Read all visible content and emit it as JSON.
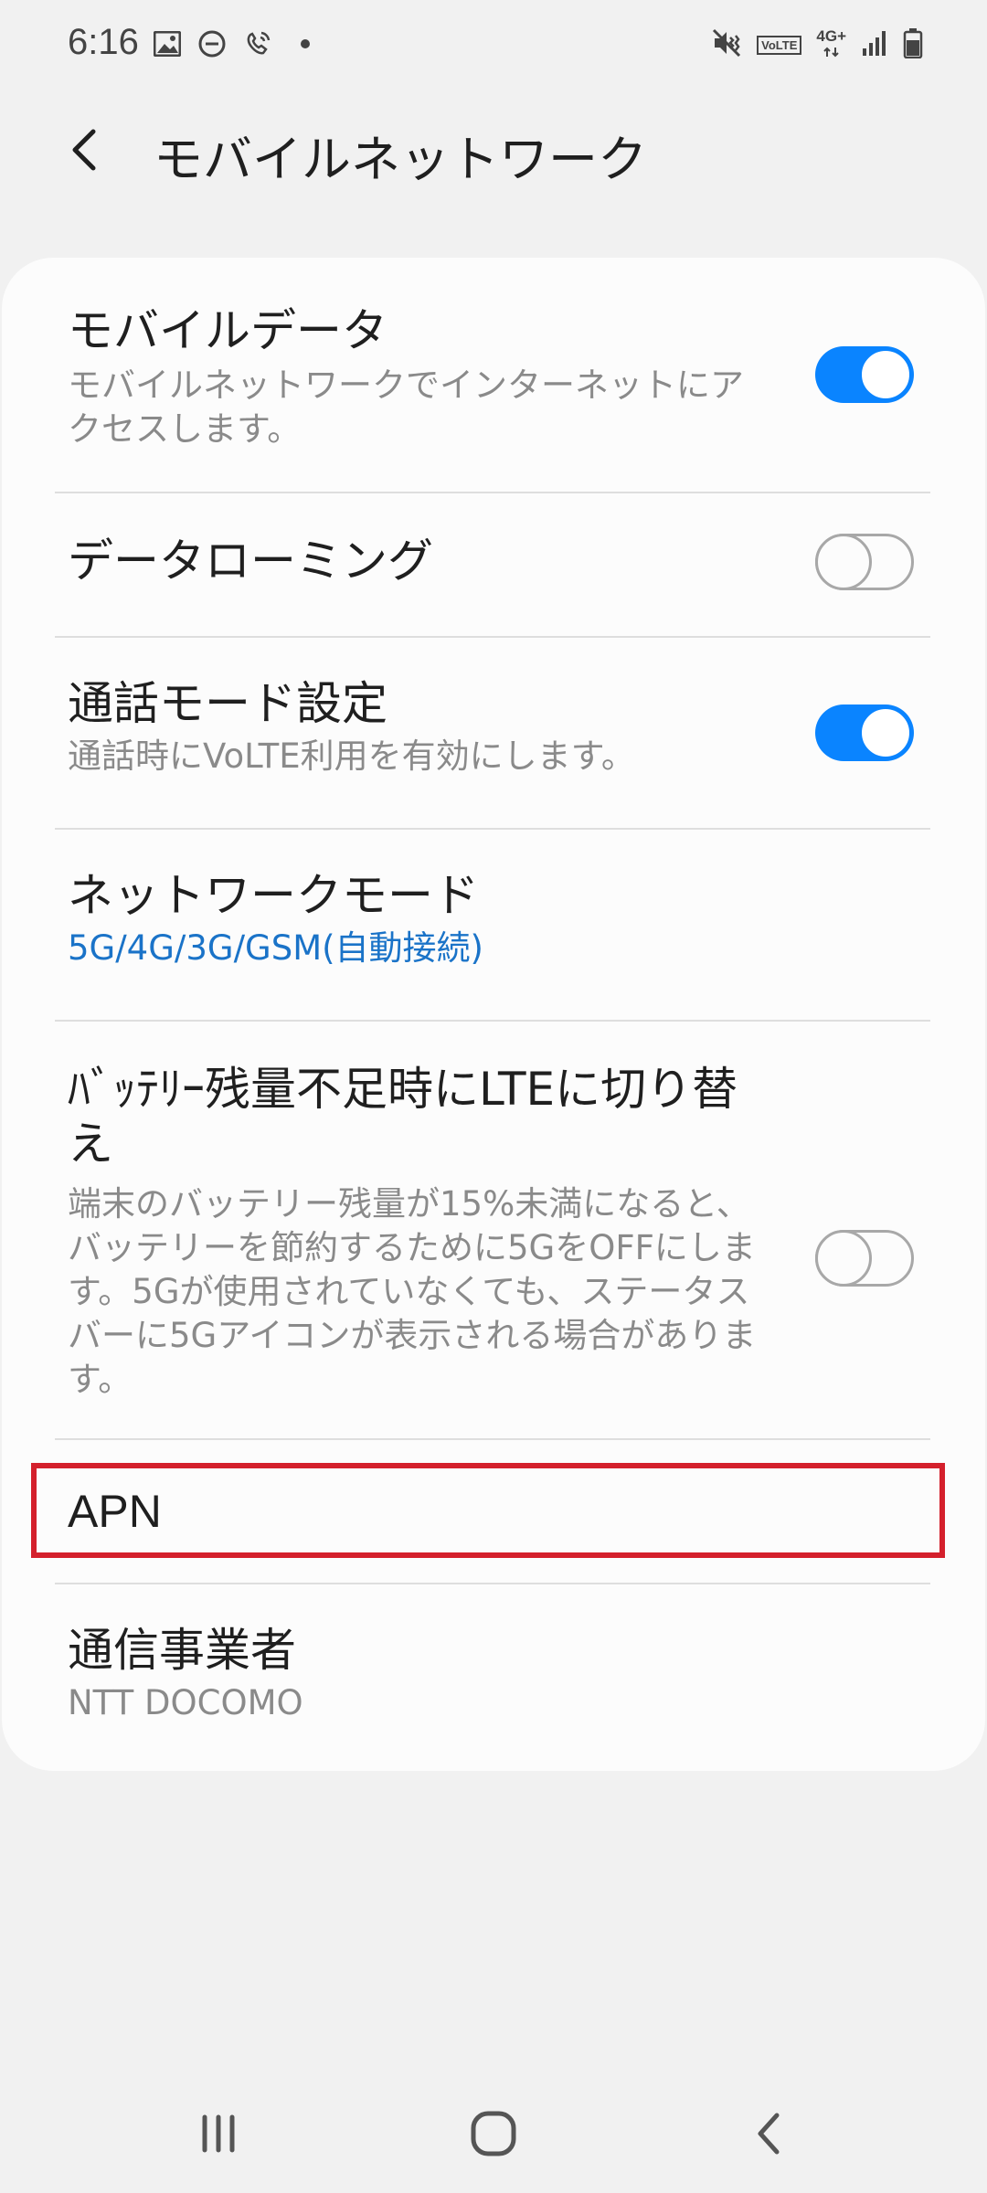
{
  "status_bar": {
    "time": "6:16",
    "network": "4G+",
    "volte": "VoLTE"
  },
  "header": {
    "title": "モバイルネットワーク"
  },
  "settings": {
    "mobile_data": {
      "title": "モバイルデータ",
      "subtitle_line1": "モバイルネットワークでインターネットにア",
      "subtitle_line2": "クセスします。",
      "enabled": true
    },
    "data_roaming": {
      "title": "データローミング",
      "enabled": false
    },
    "call_mode": {
      "title": "通話モード設定",
      "subtitle": "通話時にVoLTE利用を有効にします。",
      "enabled": true
    },
    "network_mode": {
      "title": "ネットワークモード",
      "value": "5G/4G/3G/GSM(自動接続)"
    },
    "battery_lte": {
      "title_line1": "ﾊﾞｯﾃﾘｰ残量不足時にLTEに切り替",
      "title_line2": "え",
      "desc_line1": "端末のバッテリー残量が15%未満になると、",
      "desc_line2": "バッテリーを節約するために5GをOFFにしま",
      "desc_line3": "す。5Gが使用されていなくても、ステータス",
      "desc_line4": "バーに5Gアイコンが表示される場合がありま",
      "desc_line5": "す。",
      "enabled": false
    },
    "apn": {
      "title": "APN"
    },
    "carrier": {
      "title": "通信事業者",
      "value": "NTT DOCOMO"
    }
  },
  "colors": {
    "accent": "#0a84ff",
    "link": "#1a73c8",
    "highlight": "#d4202c",
    "background": "#f1f1f1",
    "card": "#fcfcfc"
  }
}
